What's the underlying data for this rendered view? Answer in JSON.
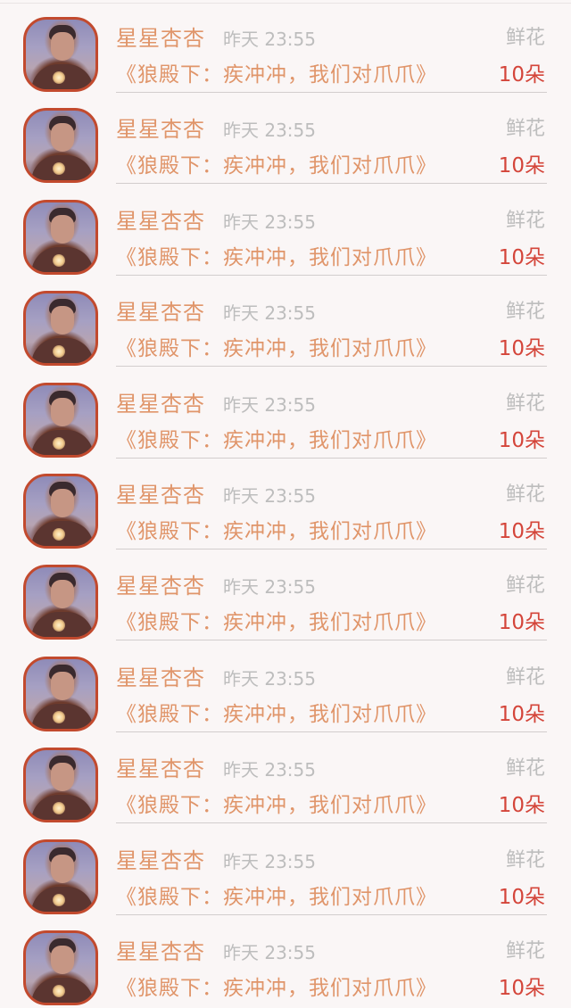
{
  "rows": [
    {
      "name": "星星杏杏",
      "time": "昨天 23:55",
      "gift": "鲜花",
      "book": "《狼殿下：疾冲冲，我们对爪爪》",
      "count": "10朵"
    },
    {
      "name": "星星杏杏",
      "time": "昨天 23:55",
      "gift": "鲜花",
      "book": "《狼殿下：疾冲冲，我们对爪爪》",
      "count": "10朵"
    },
    {
      "name": "星星杏杏",
      "time": "昨天 23:55",
      "gift": "鲜花",
      "book": "《狼殿下：疾冲冲，我们对爪爪》",
      "count": "10朵"
    },
    {
      "name": "星星杏杏",
      "time": "昨天 23:55",
      "gift": "鲜花",
      "book": "《狼殿下：疾冲冲，我们对爪爪》",
      "count": "10朵"
    },
    {
      "name": "星星杏杏",
      "time": "昨天 23:55",
      "gift": "鲜花",
      "book": "《狼殿下：疾冲冲，我们对爪爪》",
      "count": "10朵"
    },
    {
      "name": "星星杏杏",
      "time": "昨天 23:55",
      "gift": "鲜花",
      "book": "《狼殿下：疾冲冲，我们对爪爪》",
      "count": "10朵"
    },
    {
      "name": "星星杏杏",
      "time": "昨天 23:55",
      "gift": "鲜花",
      "book": "《狼殿下：疾冲冲，我们对爪爪》",
      "count": "10朵"
    },
    {
      "name": "星星杏杏",
      "time": "昨天 23:55",
      "gift": "鲜花",
      "book": "《狼殿下：疾冲冲，我们对爪爪》",
      "count": "10朵"
    },
    {
      "name": "星星杏杏",
      "time": "昨天 23:55",
      "gift": "鲜花",
      "book": "《狼殿下：疾冲冲，我们对爪爪》",
      "count": "10朵"
    },
    {
      "name": "星星杏杏",
      "time": "昨天 23:55",
      "gift": "鲜花",
      "book": "《狼殿下：疾冲冲，我们对爪爪》",
      "count": "10朵"
    },
    {
      "name": "星星杏杏",
      "time": "昨天 23:55",
      "gift": "鲜花",
      "book": "《狼殿下：疾冲冲，我们对爪爪》",
      "count": "10朵"
    }
  ],
  "colors": {
    "name": "#e0956a",
    "book": "#e0956a",
    "count": "#d4453a",
    "muted": "#bdbdbd",
    "avatar_border": "#c24a2e",
    "background": "#faf6f6"
  },
  "icons": {
    "avatar": "user-avatar-photo"
  }
}
